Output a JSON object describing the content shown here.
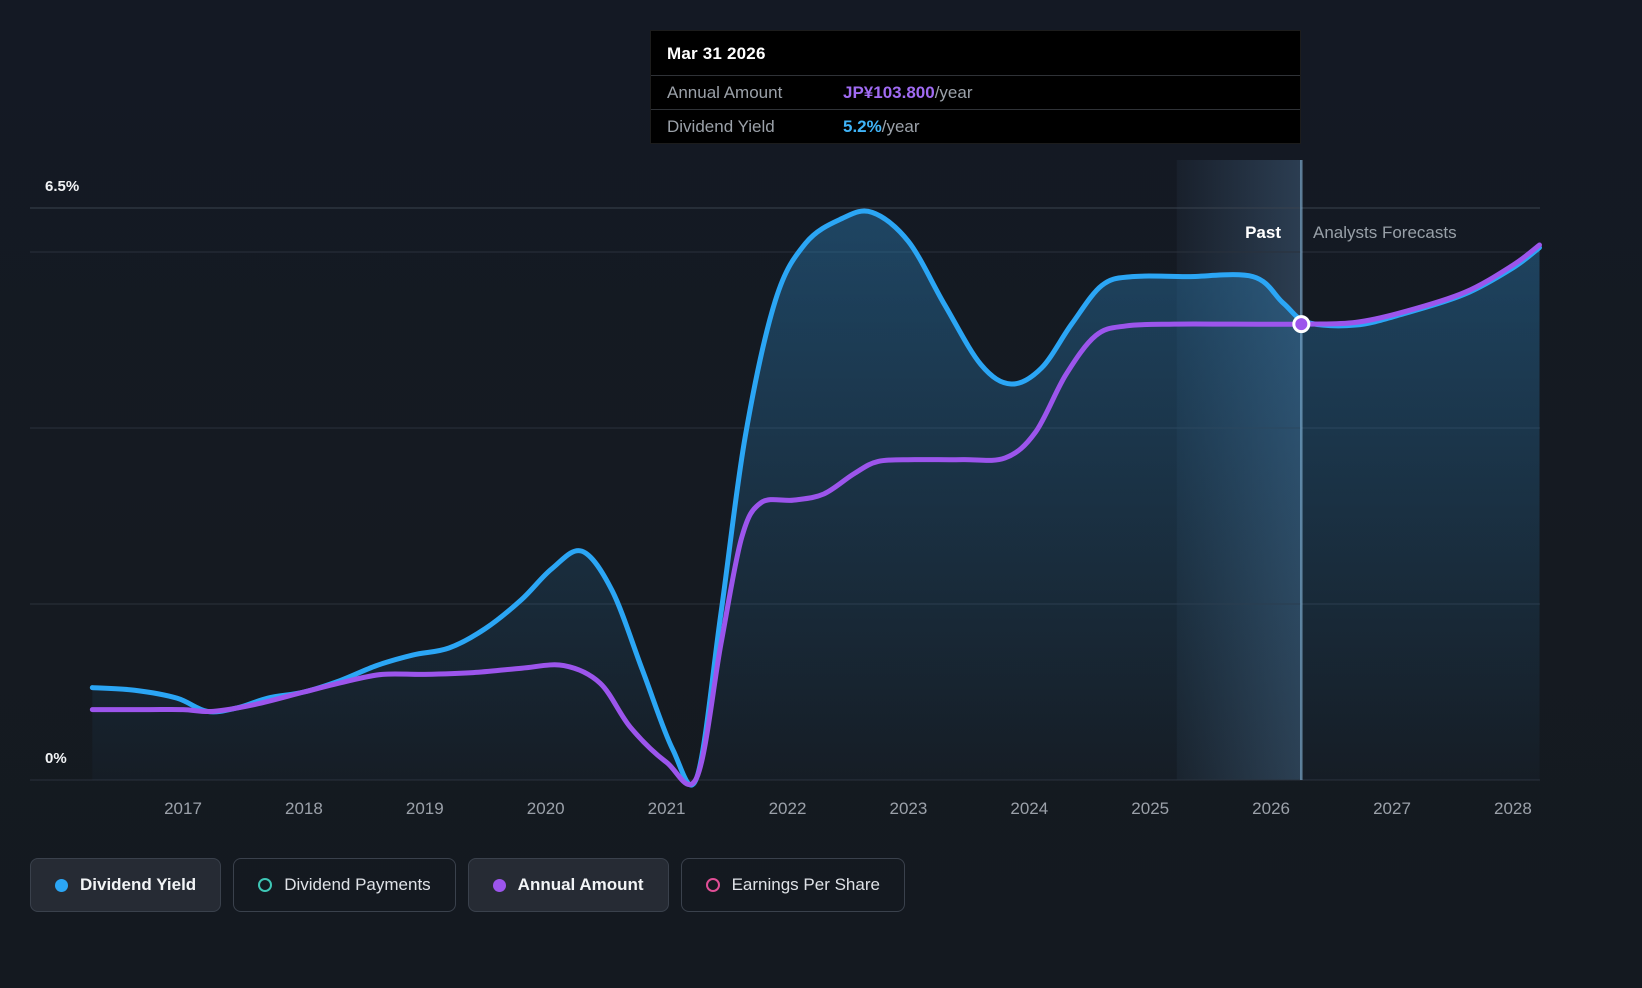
{
  "tooltip": {
    "date": "Mar 31 2026",
    "rows": [
      {
        "label": "Annual Amount",
        "value": "JP¥103.800",
        "suffix": "/year",
        "color": "#a06bf2"
      },
      {
        "label": "Dividend Yield",
        "value": "5.2%",
        "suffix": "/year",
        "color": "#3fb3f7"
      }
    ]
  },
  "axis": {
    "y_top_label": "6.5%",
    "y_zero_label": "0%"
  },
  "periods": {
    "past": "Past",
    "forecast": "Analysts Forecasts"
  },
  "legend": {
    "items": [
      {
        "label": "Dividend Yield",
        "color": "#2ba6f5",
        "marker": "filled",
        "active": true
      },
      {
        "label": "Dividend Payments",
        "color": "#3ec6b5",
        "marker": "ring",
        "active": false
      },
      {
        "label": "Annual Amount",
        "color": "#9c55ec",
        "marker": "filled",
        "active": true
      },
      {
        "label": "Earnings Per Share",
        "color": "#e04e95",
        "marker": "ring",
        "active": false
      }
    ]
  },
  "theme": {
    "background": "#151a21",
    "grid": "#2a313c",
    "grid_top": "#39424e",
    "tick_text": "#9ba1a9",
    "y_label_text": "#f2f4f6",
    "area": "#2d87c3",
    "band": "#6ea5d7",
    "divider": "#8fc2e8",
    "marker_fill": "#9c55ec",
    "marker_ring": "#ffffff"
  },
  "chart_data": {
    "type": "area",
    "title": "",
    "y_unit": "%",
    "ylim": [
      0,
      6.5
    ],
    "xlim": [
      2016.25,
      2028.25
    ],
    "gridlines_pct": [
      0,
      2,
      4,
      6,
      6.5
    ],
    "x_ticks": [
      "2017",
      "2018",
      "2019",
      "2020",
      "2021",
      "2022",
      "2023",
      "2024",
      "2025",
      "2026",
      "2027",
      "2028"
    ],
    "divider_x": 2026.25,
    "highlight_band_x": [
      2025.22,
      2026.25
    ],
    "marker": {
      "x": 2026.25,
      "y_plot": 5.18,
      "date": "Mar 31 2026",
      "annual_amount": "JP¥103.800/year",
      "dividend_yield": "5.2%/year"
    },
    "series": [
      {
        "name": "Dividend Yield",
        "color": "#2ba6f5",
        "unit": "%",
        "points": [
          [
            2016.25,
            1.05
          ],
          [
            2016.6,
            1.02
          ],
          [
            2016.95,
            0.93
          ],
          [
            2017.2,
            0.78
          ],
          [
            2017.45,
            0.82
          ],
          [
            2017.7,
            0.93
          ],
          [
            2018.0,
            1.0
          ],
          [
            2018.3,
            1.13
          ],
          [
            2018.6,
            1.3
          ],
          [
            2018.9,
            1.42
          ],
          [
            2019.2,
            1.5
          ],
          [
            2019.5,
            1.72
          ],
          [
            2019.8,
            2.05
          ],
          [
            2020.05,
            2.4
          ],
          [
            2020.3,
            2.6
          ],
          [
            2020.55,
            2.15
          ],
          [
            2020.8,
            1.25
          ],
          [
            2021.05,
            0.35
          ],
          [
            2021.25,
            0.03
          ],
          [
            2021.45,
            1.9
          ],
          [
            2021.65,
            3.9
          ],
          [
            2021.9,
            5.45
          ],
          [
            2022.15,
            6.1
          ],
          [
            2022.45,
            6.38
          ],
          [
            2022.7,
            6.45
          ],
          [
            2023.0,
            6.12
          ],
          [
            2023.3,
            5.4
          ],
          [
            2023.6,
            4.72
          ],
          [
            2023.85,
            4.5
          ],
          [
            2024.1,
            4.68
          ],
          [
            2024.35,
            5.18
          ],
          [
            2024.6,
            5.62
          ],
          [
            2024.85,
            5.72
          ],
          [
            2025.3,
            5.72
          ],
          [
            2025.85,
            5.72
          ],
          [
            2026.1,
            5.42
          ],
          [
            2026.3,
            5.2
          ],
          [
            2026.7,
            5.17
          ],
          [
            2027.1,
            5.3
          ],
          [
            2027.6,
            5.52
          ],
          [
            2028.0,
            5.82
          ],
          [
            2028.22,
            6.05
          ]
        ]
      },
      {
        "name": "Annual Amount",
        "color": "#9c55ec",
        "unit": "plotted on yield scale; JP¥103.800/year at Mar 31 2026",
        "points": [
          [
            2016.25,
            0.8
          ],
          [
            2016.7,
            0.8
          ],
          [
            2017.0,
            0.8
          ],
          [
            2017.25,
            0.78
          ],
          [
            2017.6,
            0.86
          ],
          [
            2018.0,
            1.0
          ],
          [
            2018.35,
            1.12
          ],
          [
            2018.65,
            1.2
          ],
          [
            2019.0,
            1.2
          ],
          [
            2019.4,
            1.22
          ],
          [
            2019.8,
            1.27
          ],
          [
            2020.15,
            1.3
          ],
          [
            2020.45,
            1.1
          ],
          [
            2020.7,
            0.6
          ],
          [
            2021.0,
            0.2
          ],
          [
            2021.25,
            0.03
          ],
          [
            2021.45,
            1.55
          ],
          [
            2021.62,
            2.75
          ],
          [
            2021.78,
            3.15
          ],
          [
            2022.05,
            3.18
          ],
          [
            2022.3,
            3.25
          ],
          [
            2022.55,
            3.48
          ],
          [
            2022.75,
            3.62
          ],
          [
            2023.05,
            3.64
          ],
          [
            2023.45,
            3.64
          ],
          [
            2023.8,
            3.66
          ],
          [
            2024.05,
            3.95
          ],
          [
            2024.3,
            4.6
          ],
          [
            2024.55,
            5.05
          ],
          [
            2024.8,
            5.16
          ],
          [
            2025.2,
            5.18
          ],
          [
            2025.7,
            5.18
          ],
          [
            2026.3,
            5.18
          ],
          [
            2026.7,
            5.2
          ],
          [
            2027.1,
            5.32
          ],
          [
            2027.6,
            5.54
          ],
          [
            2028.0,
            5.85
          ],
          [
            2028.22,
            6.08
          ]
        ]
      }
    ],
    "legend_position": "bottom",
    "grid": true
  }
}
